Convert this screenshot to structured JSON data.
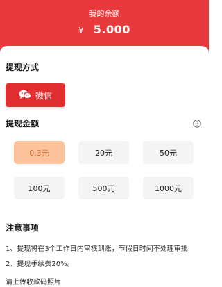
{
  "header": {
    "title": "我的余额",
    "currency_symbol": "¥",
    "balance": "5.000",
    "background_color": "#e83a3c"
  },
  "withdraw_method": {
    "title": "提现方式",
    "selected_method": {
      "label": "微信",
      "icon": "wechat-icon",
      "color": "#e12e30"
    }
  },
  "withdraw_amount": {
    "title": "提现金额",
    "help_icon": "question-circle-icon",
    "options": [
      {
        "label": "0.3元",
        "selected": true
      },
      {
        "label": "20元",
        "selected": false
      },
      {
        "label": "50元",
        "selected": false
      },
      {
        "label": "100元",
        "selected": false
      },
      {
        "label": "500元",
        "selected": false
      },
      {
        "label": "1000元",
        "selected": false
      }
    ],
    "selected_color": "#fcc29c"
  },
  "notes": {
    "title": "注意事项",
    "items": [
      "1、提现将在3个工作日内审核到账，节假日时间不处理审批",
      "2、提现手续费20%。"
    ]
  },
  "upload_prompt": "请上传收款码照片"
}
